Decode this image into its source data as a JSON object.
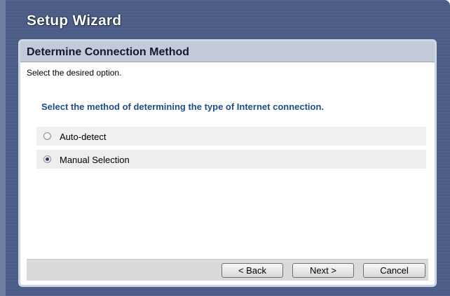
{
  "window": {
    "title": "Setup Wizard"
  },
  "panel": {
    "header": "Determine Connection Method",
    "subtitle": "Select the desired option.",
    "question": "Select the method of determining the type of Internet connection."
  },
  "options": [
    {
      "label": "Auto-detect",
      "checked": false
    },
    {
      "label": "Manual Selection",
      "checked": true
    }
  ],
  "buttons": {
    "back": "< Back",
    "next": "Next >",
    "cancel": "Cancel"
  }
}
